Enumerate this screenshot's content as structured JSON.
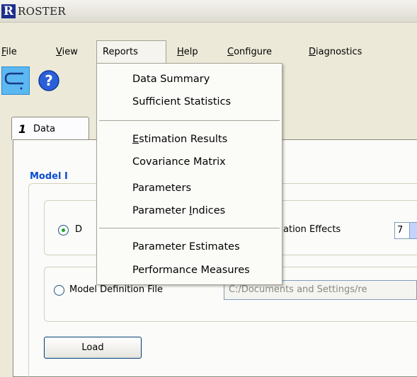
{
  "window": {
    "logo_letter": "R",
    "title": "ROSTER"
  },
  "menubar": {
    "items": [
      {
        "label_first": "F",
        "label_rest": "ile"
      },
      {
        "label_first": "V",
        "label_rest": "iew"
      },
      {
        "label_full": "Reports"
      },
      {
        "label_first": "H",
        "label_rest": "elp"
      },
      {
        "label_first": "C",
        "label_rest": "onfigure"
      },
      {
        "label_first": "D",
        "label_rest": "iagnostics"
      }
    ]
  },
  "toolbar": {
    "buttons": [
      "connect-icon",
      "help-icon"
    ]
  },
  "tabs": [
    {
      "number": "1",
      "label": "Data"
    }
  ],
  "panel": {
    "group_title": "Model I",
    "option1_label": "D",
    "option1_trailing": "ation Effects",
    "spinner_value": "7",
    "option2_label": "Model Definition File",
    "file_path": "C:/Documents and Settings/re",
    "load_button": "Load"
  },
  "reports_menu": {
    "items": [
      {
        "label": "Data Summary"
      },
      {
        "label": "Sufficient Statistics"
      },
      {
        "label_first": "E",
        "label_rest": "stimation Results"
      },
      {
        "label": "Covariance Matrix"
      },
      {
        "label": "Parameters"
      },
      {
        "label_pre": "Parameter ",
        "label_u": "I",
        "label_post": "ndices"
      },
      {
        "label": "Parameter Estimates"
      },
      {
        "label": "Performance Measures"
      }
    ]
  },
  "colors": {
    "accent_blue": "#0a4dd0",
    "window_bg": "#ece9d8",
    "radio_selected": "#21a121"
  }
}
